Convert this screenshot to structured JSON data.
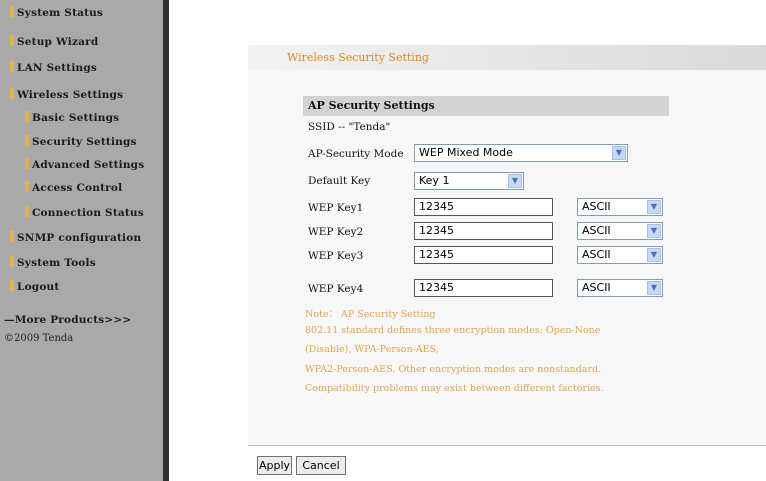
{
  "sidebar": {
    "items": [
      {
        "label": "System Status"
      },
      {
        "label": "Setup Wizard"
      },
      {
        "label": "LAN Settings"
      },
      {
        "label": "Wireless Settings"
      },
      {
        "label": "Basic Settings"
      },
      {
        "label": "Security Settings"
      },
      {
        "label": "Advanced Settings"
      },
      {
        "label": "Access Control"
      },
      {
        "label": "Connection Status"
      },
      {
        "label": "SNMP configuration"
      },
      {
        "label": "System Tools"
      },
      {
        "label": "Logout"
      }
    ],
    "more_products": "—More Products>>>",
    "copyright": "©2009 Tenda"
  },
  "main": {
    "section_title": "Wireless Security Setting",
    "ap_title": "AP Security Settings",
    "ssid_text": "SSID -- \"Tenda\"",
    "mode_label": "AP-Security Mode",
    "mode_value": "WEP Mixed Mode",
    "default_key_label": "Default Key",
    "default_key_value": "Key 1",
    "keys": [
      {
        "label": "WEP Key1",
        "value": "12345",
        "format": "ASCII"
      },
      {
        "label": "WEP Key2",
        "value": "12345",
        "format": "ASCII"
      },
      {
        "label": "WEP Key3",
        "value": "12345",
        "format": "ASCII"
      },
      {
        "label": "WEP Key4",
        "value": "12345",
        "format": "ASCII"
      }
    ],
    "note_lines": [
      "Note：  AP Security Setting",
      "802.11 standard defines three encryption modes: Open-None",
      "(Disable), WPA-Person-AES,",
      "WPA2-Person-AES. Other encryption modes are nonstandard.",
      "Compatibility problems may exist between different factories."
    ]
  },
  "footer": {
    "apply_label": "Apply",
    "cancel_label": "Cancel"
  },
  "colors": {
    "sidebar_bg": "#a9a9a9",
    "accent_orange": "#d88a1f",
    "note_text": "#e0a550"
  }
}
